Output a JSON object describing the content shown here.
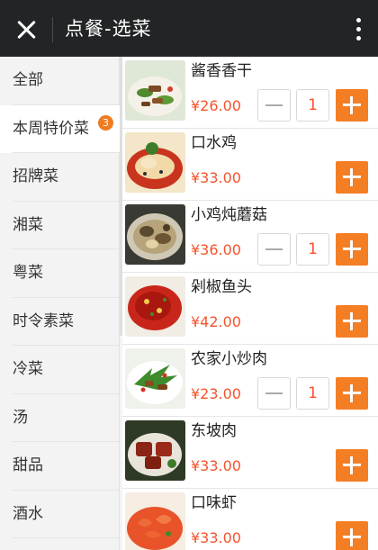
{
  "header": {
    "title": "点餐-选菜",
    "close_icon": "close-icon",
    "more_icon": "more-vertical-icon"
  },
  "sidebar": {
    "items": [
      {
        "label": "全部"
      },
      {
        "label": "本周特价菜",
        "badge": "3",
        "active": true
      },
      {
        "label": "招牌菜"
      },
      {
        "label": "湘菜"
      },
      {
        "label": "粤菜"
      },
      {
        "label": "时令素菜"
      },
      {
        "label": "冷菜"
      },
      {
        "label": "汤"
      },
      {
        "label": "甜品"
      },
      {
        "label": "酒水"
      }
    ]
  },
  "dishes": [
    {
      "name": "酱香香干",
      "price": "¥26.00",
      "qty": "1"
    },
    {
      "name": "口水鸡",
      "price": "¥33.00"
    },
    {
      "name": "小鸡炖蘑菇",
      "price": "¥36.00",
      "qty": "1"
    },
    {
      "name": "剁椒鱼头",
      "price": "¥42.00"
    },
    {
      "name": "农家小炒肉",
      "price": "¥23.00",
      "qty": "1"
    },
    {
      "name": "东坡肉",
      "price": "¥33.00"
    },
    {
      "name": "口味虾",
      "price": "¥33.00"
    }
  ],
  "colors": {
    "header_bg": "#222425",
    "accent_orange": "#f47e24",
    "price_red": "#f4542c",
    "badge_orange": "#f07c22"
  }
}
